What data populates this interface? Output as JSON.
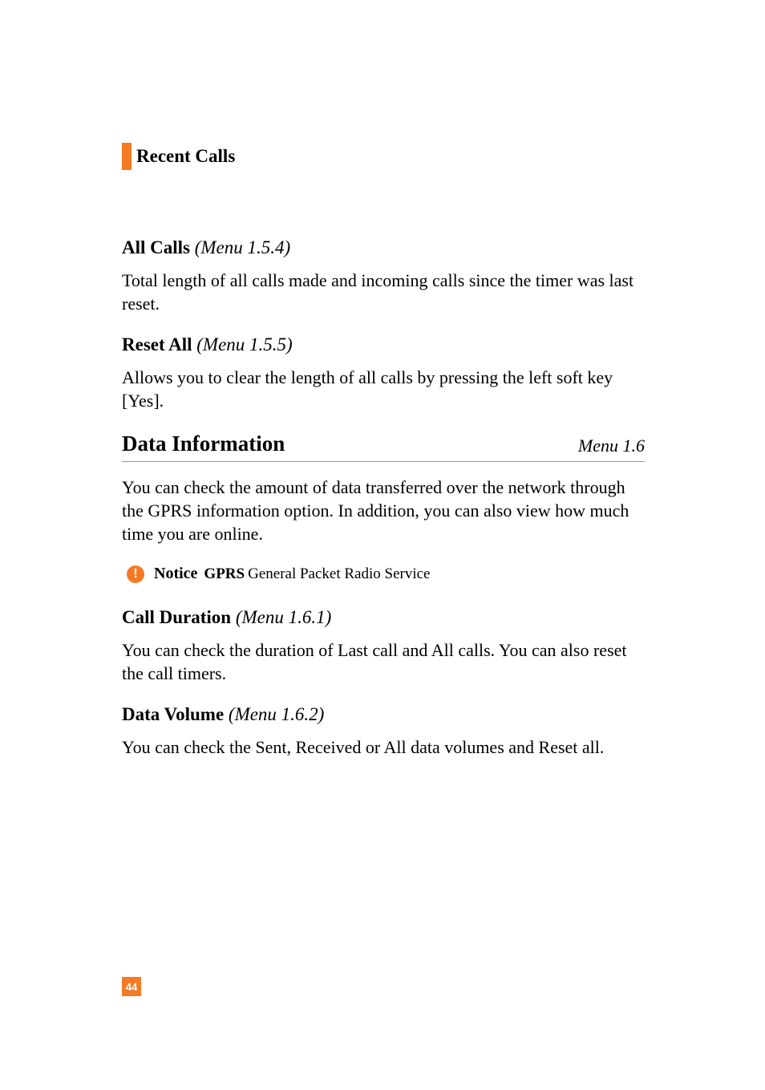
{
  "header": {
    "title": "Recent Calls"
  },
  "sections": {
    "allCalls": {
      "heading": "All Calls",
      "menuRef": "(Menu 1.5.4)",
      "body": "Total length of all calls made and incoming calls since the timer was last reset."
    },
    "resetAll": {
      "heading": "Reset All",
      "menuRef": "(Menu 1.5.5)",
      "body": "Allows you to clear the length of all calls by pressing the left soft key [Yes]."
    },
    "dataInfo": {
      "title": "Data Information",
      "menu": "Menu 1.6",
      "body": "You can check the amount of data transferred over the network through the GPRS information option. In addition, you can also view how much time you are online."
    },
    "notice": {
      "iconGlyph": "!",
      "label": "Notice",
      "gprs": "GPRS",
      "desc": "General Packet Radio Service"
    },
    "callDuration": {
      "heading": "Call Duration",
      "menuRef": "(Menu 1.6.1)",
      "body": "You can check the duration of Last call and All calls. You can also reset the call timers."
    },
    "dataVolume": {
      "heading": "Data Volume",
      "menuRef": "(Menu 1.6.2)",
      "body": "You can check the Sent, Received or All data volumes and Reset all."
    }
  },
  "pageNumber": "44"
}
